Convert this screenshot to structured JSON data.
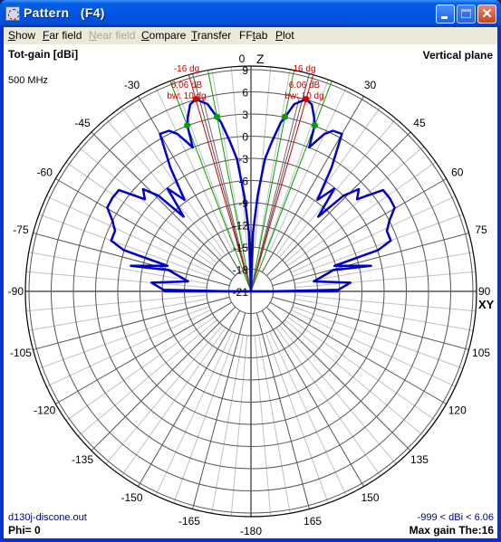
{
  "window": {
    "title": "Pattern   (F4)",
    "buttons": {
      "minimize": "minimize",
      "maximize": "maximize",
      "close": "✕"
    }
  },
  "menu": [
    {
      "label": "Show",
      "underline": "S",
      "enabled": true
    },
    {
      "label": "Far field",
      "underline": "F",
      "enabled": true
    },
    {
      "label": "Near field",
      "underline": "N",
      "enabled": false
    },
    {
      "label": "Compare",
      "underline": "C",
      "enabled": true
    },
    {
      "label": "Transfer",
      "underline": "T",
      "enabled": true
    },
    {
      "label": "FFtab",
      "underline": "t",
      "enabled": true
    },
    {
      "label": "Plot",
      "underline": "P",
      "enabled": true
    }
  ],
  "header": {
    "quantity": "Tot-gain [dBi]",
    "frequency": "500 MHz",
    "plane": "Vertical plane"
  },
  "footer": {
    "file": "d130j-discone.out",
    "phi": "Phi= 0",
    "range": "-999 < dBi < 6.06",
    "max_gain": "Max gain The:16"
  },
  "colors": {
    "pattern": "#0000c8",
    "marker_red": "#cc0000",
    "marker_green": "#00a000",
    "grid_major": "#555555",
    "grid_minor": "#c0c0c0",
    "annotation": "#cc0000",
    "footer_blue": "#000080"
  },
  "chart_data": {
    "type": "polar",
    "title": "Tot-gain [dBi]",
    "subtitle": "Vertical plane",
    "frequency": "500 MHz",
    "axis_top_label": "Z",
    "axis_right_label": "XY",
    "radial": {
      "unit": "dBi",
      "min": -21,
      "max": 9,
      "ticks": [
        9,
        6,
        3,
        0,
        -3,
        -6,
        -9,
        -12,
        -15,
        -18,
        -21
      ],
      "grid": true
    },
    "angular": {
      "unit": "deg",
      "zero": "top",
      "direction": "clockwise",
      "ticks": [
        0,
        30,
        45,
        60,
        75,
        90,
        105,
        120,
        135,
        150,
        165,
        -180,
        -165,
        -150,
        -135,
        -120,
        -105,
        -90,
        -75,
        -60,
        -45,
        -30
      ],
      "major_step": 15,
      "minor_step": 5
    },
    "series": [
      {
        "name": "Tot-gain phi=0",
        "symmetric": true,
        "points": [
          [
            0,
            -21
          ],
          [
            2,
            -13
          ],
          [
            4,
            -8
          ],
          [
            6,
            -3
          ],
          [
            8,
            -0.5
          ],
          [
            10,
            2.2
          ],
          [
            11,
            3
          ],
          [
            13,
            5
          ],
          [
            16,
            6.06
          ],
          [
            18,
            5.6
          ],
          [
            20,
            4
          ],
          [
            21,
            3
          ],
          [
            22,
            0
          ],
          [
            23,
            0.8
          ],
          [
            25,
            2.5
          ],
          [
            27,
            3.4
          ],
          [
            30,
            3.6
          ],
          [
            33,
            -1
          ],
          [
            36,
            -5.7
          ],
          [
            39,
            -3.1
          ],
          [
            42,
            -7.4
          ],
          [
            44,
            -3
          ],
          [
            46.5,
            -0.9
          ],
          [
            49,
            -2
          ],
          [
            52.5,
            1.5
          ],
          [
            56,
            1.6
          ],
          [
            59.7,
            1.5
          ],
          [
            63,
            0
          ],
          [
            66,
            -0.9
          ],
          [
            70,
            -0.9
          ],
          [
            72,
            -2.9
          ],
          [
            73,
            -9.2
          ],
          [
            78,
            -4.4
          ],
          [
            75.5,
            -9.5
          ],
          [
            81,
            -12.4
          ],
          [
            85,
            -7.5
          ],
          [
            89,
            -9.2
          ],
          [
            90,
            -18.2
          ],
          [
            90,
            -21
          ]
        ]
      }
    ],
    "markers": [
      {
        "side": "left",
        "angle": -16,
        "gain": 6.06,
        "beamwidth": 10,
        "half_power_angles": [
          -21,
          -11
        ],
        "labels": [
          "-16 dg",
          "6.06 dB",
          "bw: 10 dg"
        ]
      },
      {
        "side": "right",
        "angle": 16,
        "gain": 6.06,
        "beamwidth": 10,
        "half_power_angles": [
          11,
          21
        ],
        "labels": [
          "16 dg",
          "6.06 dB",
          "bw: 10 dg"
        ]
      }
    ],
    "max_gain": 6.06,
    "max_gain_theta": 16,
    "phi": 0
  }
}
